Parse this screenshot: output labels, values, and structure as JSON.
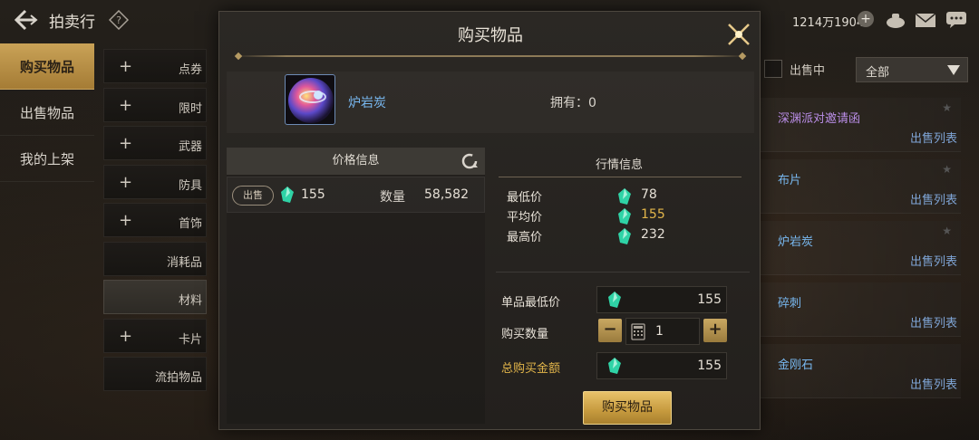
{
  "header": {
    "title": "拍卖行",
    "currency": "1214万1904"
  },
  "leftnav": {
    "items": [
      {
        "label": "购买物品"
      },
      {
        "label": "出售物品"
      },
      {
        "label": "我的上架"
      }
    ]
  },
  "categories": {
    "items": [
      {
        "label": "点券",
        "plus": "+"
      },
      {
        "label": "限时",
        "plus": "+"
      },
      {
        "label": "武器",
        "plus": "+"
      },
      {
        "label": "防具",
        "plus": "+"
      },
      {
        "label": "首饰",
        "plus": "+"
      },
      {
        "label": "消耗品",
        "plus": ""
      },
      {
        "label": "材料",
        "plus": ""
      },
      {
        "label": "卡片",
        "plus": "+"
      },
      {
        "label": "流拍物品",
        "plus": ""
      }
    ]
  },
  "rightpanel": {
    "on_sale_label": "出售中",
    "filter_value": "全部",
    "rows": [
      {
        "name": "深渊派对邀请函",
        "link": "出售列表",
        "name_color": "#b98de6"
      },
      {
        "name": "布片",
        "link": "出售列表",
        "name_color": "#78b8f0"
      },
      {
        "name": "炉岩炭",
        "link": "出售列表",
        "name_color": "#78b8f0"
      },
      {
        "name": "碎刺",
        "link": "出售列表",
        "name_color": "#78b8f0"
      },
      {
        "name": "金刚石",
        "link": "出售列表",
        "name_color": "#78b8f0"
      }
    ]
  },
  "modal": {
    "title": "购买物品",
    "item_name": "炉岩炭",
    "owned": "拥有：0",
    "price_info_title": "价格信息",
    "listing": {
      "badge": "出售",
      "price": "155",
      "qty_label": "数量",
      "qty": "58,582"
    },
    "market": {
      "title": "行情信息",
      "min_label": "最低价",
      "min_value": "78",
      "avg_label": "平均价",
      "avg_value": "155",
      "max_label": "最高价",
      "max_value": "232"
    },
    "form": {
      "unit_min_label": "单品最低价",
      "unit_min_value": "155",
      "buy_qty_label": "购买数量",
      "buy_qty_value": "1",
      "total_label": "总购买金额",
      "total_value": "155"
    },
    "buy_button": "购买物品"
  },
  "colors": {
    "accent_gold": "#c9a257",
    "item_blue": "#78b8f0",
    "avg_price": "#e2b54a",
    "gem": "#2fd3a6"
  }
}
